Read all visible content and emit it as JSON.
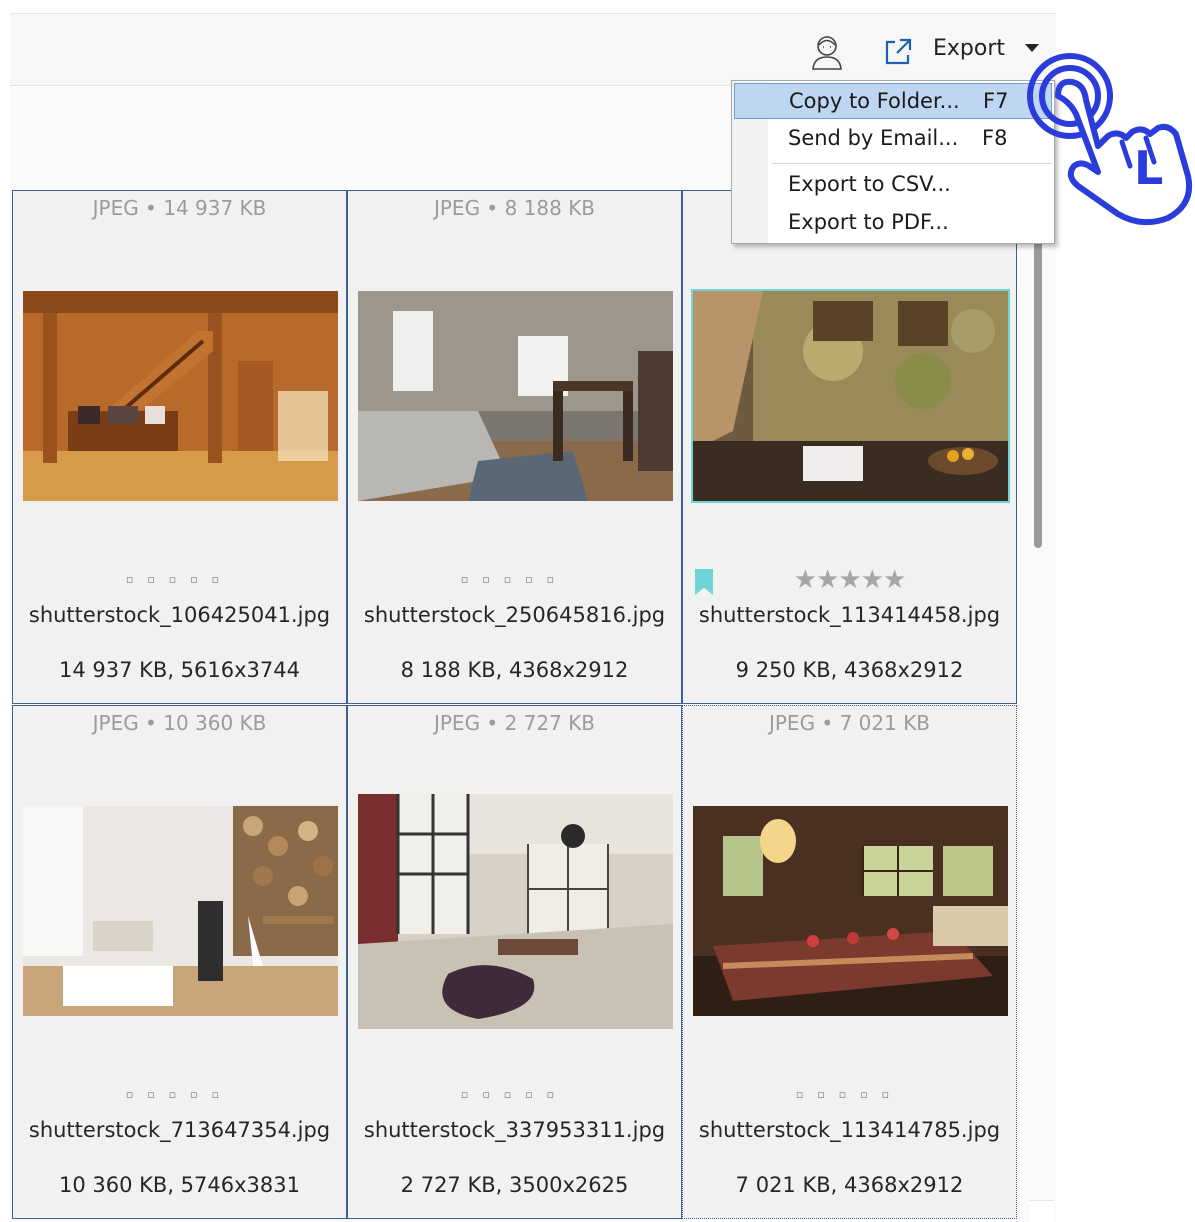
{
  "toolbar": {
    "export_label": "Export"
  },
  "export_menu": {
    "items": [
      {
        "label": "Copy to Folder...",
        "shortcut": "F7"
      },
      {
        "label": "Send by Email...",
        "shortcut": "F8"
      },
      {
        "label": "Export to CSV...",
        "shortcut": ""
      },
      {
        "label": "Export to PDF...",
        "shortcut": ""
      }
    ]
  },
  "grid": {
    "tiles": [
      {
        "header": "JPEG • 14 937 KB",
        "name": "shutterstock_106425041.jpg",
        "meta": "14 937 KB, 5616x3744",
        "rating": 0
      },
      {
        "header": "JPEG • 8 188 KB",
        "name": "shutterstock_250645816.jpg",
        "meta": "8 188 KB, 4368x2912",
        "rating": 0
      },
      {
        "header": "",
        "name": "shutterstock_113414458.jpg",
        "meta": "9 250 KB, 4368x2912",
        "rating": 5,
        "stars": "★★★★★",
        "bookmarked": true,
        "selected": true
      },
      {
        "header": "JPEG • 10 360 KB",
        "name": "shutterstock_713647354.jpg",
        "meta": "10 360 KB, 5746x3831",
        "rating": 0
      },
      {
        "header": "JPEG • 2 727 KB",
        "name": "shutterstock_337953311.jpg",
        "meta": "2 727 KB, 3500x2625",
        "rating": 0
      },
      {
        "header": "JPEG • 7 021 KB",
        "name": "shutterstock_113414785.jpg",
        "meta": "7 021 KB, 4368x2912",
        "rating": 0
      }
    ],
    "empty_rating_glyph": "▫▫▫▫▫"
  },
  "hand_cursor": {
    "letter": "L"
  },
  "colors": {
    "tile_border": "#3f6190",
    "menu_highlight": "#bed6f1",
    "selection_cyan": "#6fd4d7",
    "hand_blue": "#2a3ddb"
  }
}
